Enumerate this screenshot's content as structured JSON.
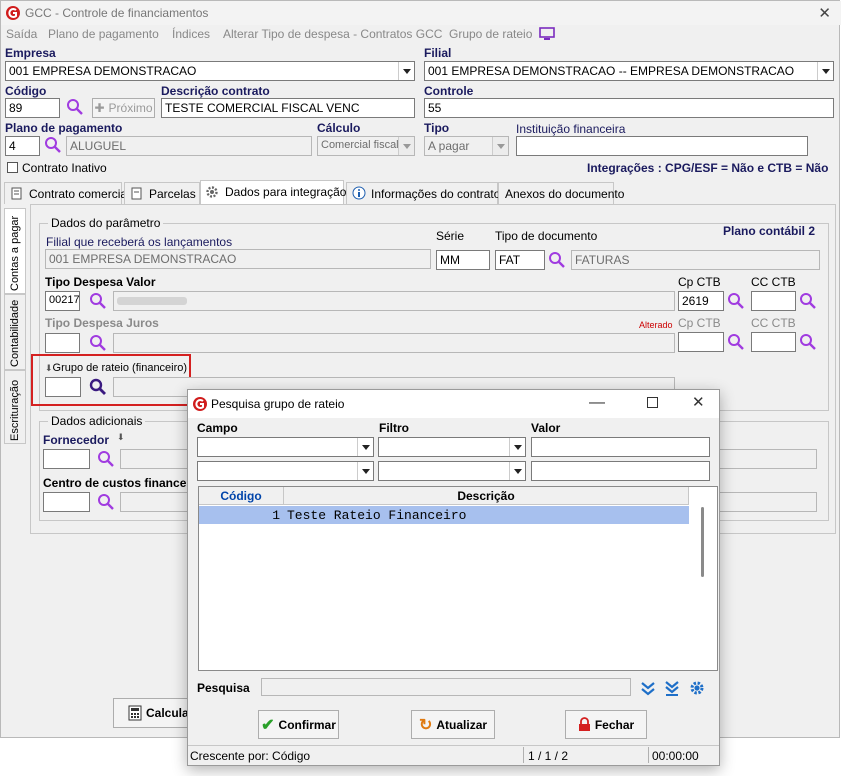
{
  "window": {
    "title": "GCC - Controle de financiamentos"
  },
  "menu": [
    "Saída",
    "Plano de pagamento",
    "Índices",
    "Alterar Tipo de despesa - Contratos GCC",
    "Grupo de rateio"
  ],
  "header": {
    "empresa_label": "Empresa",
    "empresa_value": "001 EMPRESA DEMONSTRACAO",
    "filial_label": "Filial",
    "filial_value": "001 EMPRESA DEMONSTRACAO -- EMPRESA DEMONSTRACAO",
    "codigo_label": "Código",
    "codigo_value": "89",
    "proximo_label": "Próximo",
    "descricao_label": "Descrição contrato",
    "descricao_value": "TESTE COMERCIAL FISCAL VENC",
    "controle_label": "Controle",
    "controle_value": "55",
    "plano_label": "Plano de pagamento",
    "plano_code": "4",
    "plano_value": "ALUGUEL",
    "calculo_label": "Cálculo",
    "calculo_value": "Comercial fiscal",
    "tipo_label": "Tipo",
    "tipo_value": "A pagar",
    "instituicao_label": "Instituição financeira",
    "instituicao_value": "",
    "contrato_inativo_label": "Contrato Inativo",
    "integracoes": "Integrações : CPG/ESF = Não e CTB = Não"
  },
  "tabs": [
    "Contrato comercial",
    "Parcelas",
    "Dados para integração",
    "Informações do contrato",
    "Anexos do documento"
  ],
  "vtabs": [
    "Contas a pagar",
    "Contabilidade",
    "Escrituração"
  ],
  "parametro": {
    "group_title": "Dados do parâmetro",
    "plano_contabil": "Plano contábil 2",
    "filial_label": "Filial que receberá os lançamentos",
    "filial_value": "001 EMPRESA DEMONSTRACAO",
    "serie_label": "Série",
    "serie_value": "MM",
    "tipo_doc_label": "Tipo de documento",
    "tipo_doc_code": "FAT",
    "tipo_doc_value": "FATURAS",
    "tipo_desp_valor_label": "Tipo Despesa Valor",
    "tipo_desp_valor_code": "00217",
    "cp_ctb_label": "Cp CTB",
    "cp_ctb_value": "2619",
    "cc_ctb_label": "CC CTB",
    "tipo_desp_juros_label": "Tipo Despesa Juros",
    "alterado_label": "Alterado",
    "cp_ctb2_label": "Cp CTB",
    "cc_ctb2_label": "CC CTB",
    "grupo_rateio_label": "Grupo de rateio (financeiro)"
  },
  "adicionais": {
    "group_title": "Dados adicionais",
    "fornecedor_label": "Fornecedor",
    "centro_custos_label": "Centro de custos finance"
  },
  "footer": {
    "calcular_label": "Calcula"
  },
  "dialog": {
    "title": "Pesquisa grupo de rateio",
    "campo_label": "Campo",
    "filtro_label": "Filtro",
    "valor_label": "Valor",
    "grid_headers": [
      "Código",
      "Descrição"
    ],
    "rows": [
      {
        "codigo": "1",
        "descricao": "Teste Rateio Financeiro"
      }
    ],
    "pesquisa_label": "Pesquisa",
    "confirmar_label": "Confirmar",
    "atualizar_label": "Atualizar",
    "fechar_label": "Fechar",
    "status_order": "Crescente por: Código",
    "status_pages": "1 / 1 / 2",
    "status_time": "00:00:00"
  },
  "colors": {
    "accent": "#7a2bbf",
    "highlight": "#a7c0ee",
    "error": "#cc0000",
    "label_blue": "#1a1a5e",
    "code_blue": "#0044aa"
  }
}
